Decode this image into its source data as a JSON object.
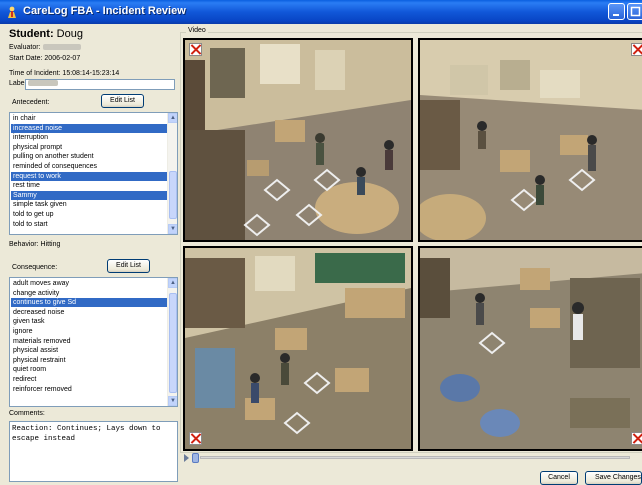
{
  "window": {
    "title": "CareLog FBA - Incident Review"
  },
  "student": {
    "heading": "Student:",
    "name": "Doug"
  },
  "meta": {
    "evaluator_label": "Evaluator:",
    "start_date": "Start Date: 2006-02-07",
    "incident_time": "Time of Incident: 15:08:14-15:23:14",
    "label_caption": "Label:"
  },
  "antecedent": {
    "caption": "Antecedent:",
    "edit_button": "Edit List",
    "items": [
      {
        "text": "in chair",
        "selected": false
      },
      {
        "text": "increased noise",
        "selected": true
      },
      {
        "text": "interruption",
        "selected": false
      },
      {
        "text": "physical prompt",
        "selected": false
      },
      {
        "text": "pulling on another student",
        "selected": false
      },
      {
        "text": "reminded of consequences",
        "selected": false
      },
      {
        "text": "request to work",
        "selected": true
      },
      {
        "text": "rest time",
        "selected": false
      },
      {
        "text": "Sammy",
        "selected": true
      },
      {
        "text": "simple task given",
        "selected": false
      },
      {
        "text": "told to get up",
        "selected": false
      },
      {
        "text": "told to start",
        "selected": false
      }
    ]
  },
  "behavior": {
    "text": "Behavior: Hitting"
  },
  "consequence": {
    "caption": "Consequence:",
    "edit_button": "Edit List",
    "items": [
      {
        "text": "adult moves away",
        "selected": false
      },
      {
        "text": "change activity",
        "selected": false
      },
      {
        "text": "continues to give Sd",
        "selected": true
      },
      {
        "text": "decreased noise",
        "selected": false
      },
      {
        "text": "given task",
        "selected": false
      },
      {
        "text": "ignore",
        "selected": false
      },
      {
        "text": "materials removed",
        "selected": false
      },
      {
        "text": "physical assist",
        "selected": false
      },
      {
        "text": "physical restraint",
        "selected": false
      },
      {
        "text": "quiet room",
        "selected": false
      },
      {
        "text": "redirect",
        "selected": false
      },
      {
        "text": "reinforcer removed",
        "selected": false
      }
    ]
  },
  "comments": {
    "caption": "Comments:",
    "text": "Reaction: Continues; Lays down to\nescape instead"
  },
  "video": {
    "legend": "Video"
  },
  "footer": {
    "cancel_label": "Cancel",
    "save_label": "Save Changes"
  },
  "colors": {
    "title_bar": "#0a5fe0",
    "selection": "#316ac5",
    "window_bg": "#ece9d8"
  }
}
